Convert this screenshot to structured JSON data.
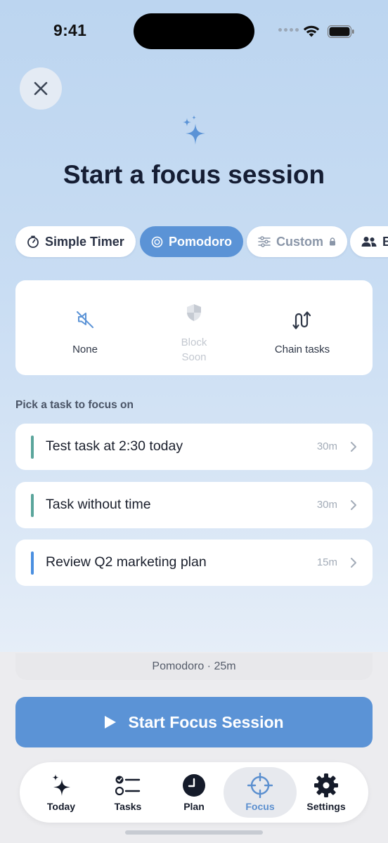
{
  "status": {
    "time": "9:41"
  },
  "header": {
    "title": "Start a focus session"
  },
  "modes": [
    {
      "label": "Simple Timer",
      "icon": "timer-icon",
      "state": "default"
    },
    {
      "label": "Pomodoro",
      "icon": "pomodoro-icon",
      "state": "active"
    },
    {
      "label": "Custom",
      "icon": "sliders-icon",
      "state": "locked"
    },
    {
      "label": "B",
      "icon": "people-icon",
      "state": "default"
    }
  ],
  "options": [
    {
      "label": "None",
      "icon": "mute-icon",
      "disabled": false
    },
    {
      "label": "Block Soon",
      "icon": "shield-icon",
      "disabled": true
    },
    {
      "label": "Chain tasks",
      "icon": "chain-arrows-icon",
      "disabled": false
    }
  ],
  "tasks_section": {
    "label": "Pick a task to focus on"
  },
  "tasks": [
    {
      "title": "Test task at 2:30 today",
      "duration": "30m",
      "color": "#5aa59b"
    },
    {
      "title": "Task without time",
      "duration": "30m",
      "color": "#5aa59b"
    },
    {
      "title": "Review Q2 marketing plan",
      "duration": "15m",
      "color": "#4a8fe0"
    }
  ],
  "summary": {
    "text": "Pomodoro · 25m"
  },
  "start_button": {
    "label": "Start Focus Session"
  },
  "tabbar": {
    "active": "Focus",
    "items": [
      {
        "label": "Today",
        "icon": "sparkles-icon"
      },
      {
        "label": "Tasks",
        "icon": "checklist-icon"
      },
      {
        "label": "Plan",
        "icon": "clock-icon"
      },
      {
        "label": "Focus",
        "icon": "crosshair-icon"
      },
      {
        "label": "Settings",
        "icon": "gear-icon"
      }
    ]
  },
  "colors": {
    "accent": "#5b93d6",
    "title": "#151d33",
    "active_tab": "#5b8fcf"
  }
}
